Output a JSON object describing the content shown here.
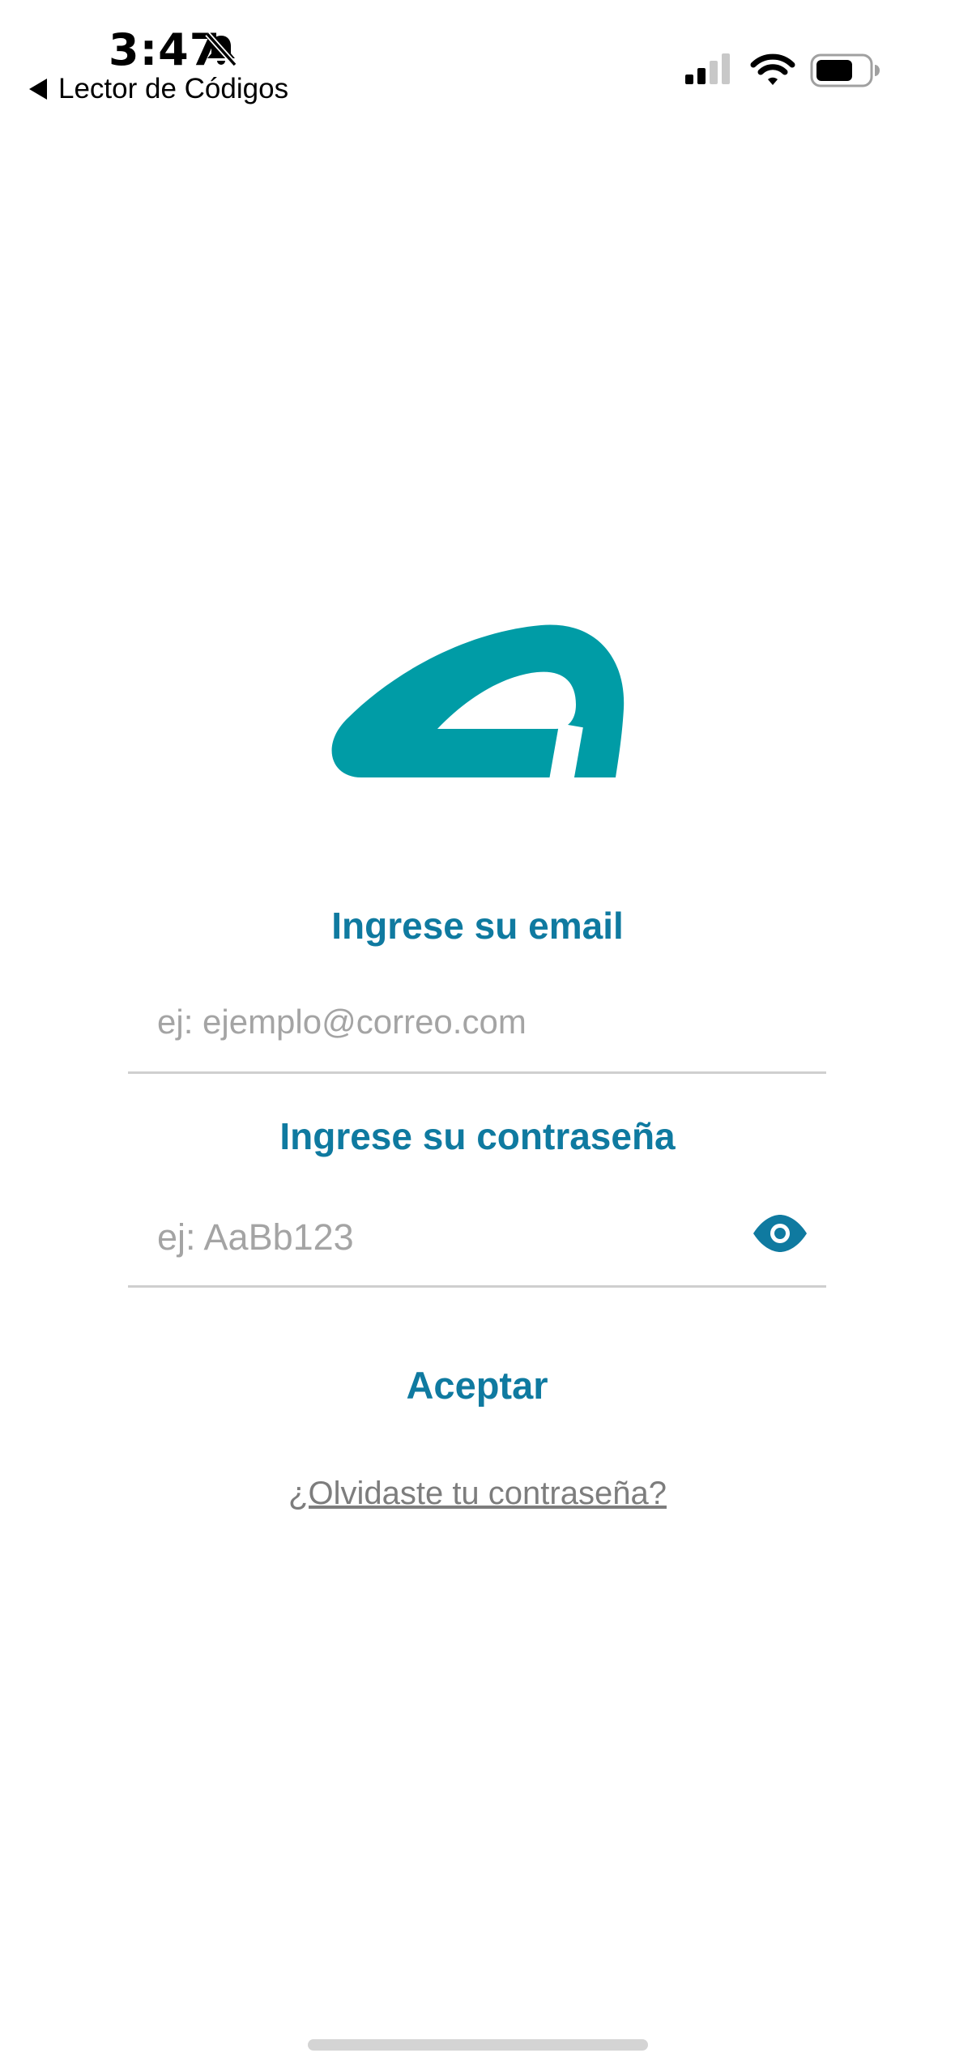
{
  "status_bar": {
    "time": "3:47",
    "back_label": "Lector de Códigos",
    "icons": [
      "bell-slash-icon",
      "cellular-signal-icon",
      "wifi-icon",
      "battery-icon"
    ]
  },
  "brand": {
    "logo_icon": "teal-arch-logo",
    "accent_color": "#009ca6",
    "label_color": "#0f7aa0"
  },
  "login_form": {
    "email_label": "Ingrese su email",
    "email_placeholder": "ej: ejemplo@correo.com",
    "email_value": "",
    "password_label": "Ingrese su contraseña",
    "password_placeholder": "ej: AaBb123",
    "password_value": "",
    "toggle_visibility_icon": "eye-icon",
    "submit_label": "Aceptar",
    "forgot_password_label": "¿Olvidaste tu contraseña?"
  }
}
